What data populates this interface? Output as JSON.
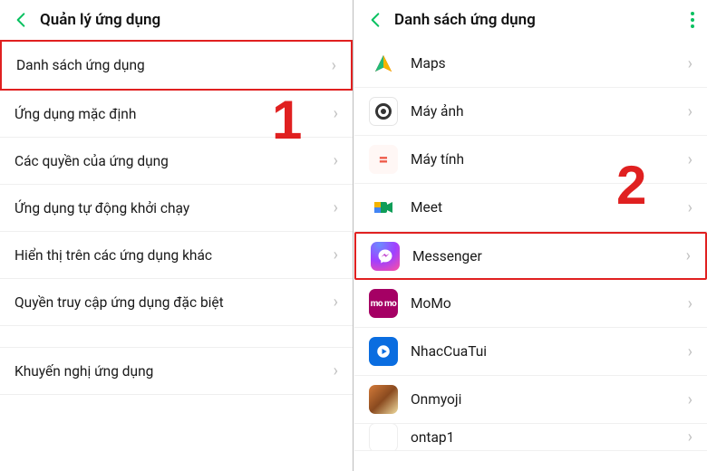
{
  "left": {
    "title": "Quản lý ứng dụng",
    "items": [
      {
        "label": "Danh sách ứng dụng"
      },
      {
        "label": "Ứng dụng mặc định"
      },
      {
        "label": "Các quyền của ứng dụng"
      },
      {
        "label": "Ứng dụng tự động khởi chạy"
      },
      {
        "label": "Hiển thị trên các ứng dụng khác"
      },
      {
        "label": "Quyền truy cập ứng dụng đặc biệt"
      }
    ],
    "recommend": "Khuyến nghị ứng dụng"
  },
  "right": {
    "title": "Danh sách ứng dụng",
    "apps": [
      {
        "label": "Maps"
      },
      {
        "label": "Máy ảnh"
      },
      {
        "label": "Máy tính"
      },
      {
        "label": "Meet"
      },
      {
        "label": "Messenger"
      },
      {
        "label": "MoMo"
      },
      {
        "label": "NhacCuaTui"
      },
      {
        "label": "Onmyoji"
      },
      {
        "label": "ontap1"
      }
    ]
  },
  "callouts": {
    "one": "1",
    "two": "2"
  },
  "momo_text": "mo\nmo"
}
